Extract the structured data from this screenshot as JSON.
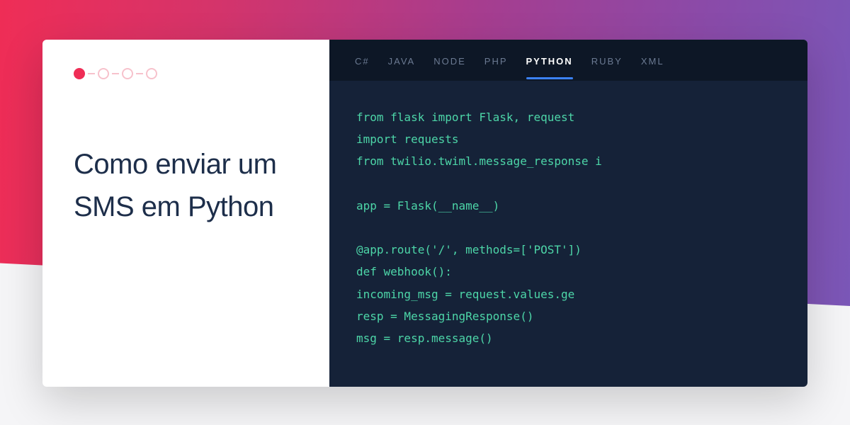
{
  "title": "Como enviar um\nSMS em Python",
  "tabs": [
    {
      "label": "C#",
      "active": false
    },
    {
      "label": "JAVA",
      "active": false
    },
    {
      "label": "NODE",
      "active": false
    },
    {
      "label": "PHP",
      "active": false
    },
    {
      "label": "PYTHON",
      "active": true
    },
    {
      "label": "RUBY",
      "active": false
    },
    {
      "label": "XML",
      "active": false
    }
  ],
  "code_lines": [
    "from flask import Flask, request",
    "import requests",
    "from twilio.twiml.message_response i",
    "",
    "app = Flask(__name__)",
    "",
    "@app.route('/', methods=['POST'])",
    "def webhook():",
    "incoming_msg = request.values.ge",
    "resp = MessagingResponse()",
    "msg = resp.message()"
  ]
}
